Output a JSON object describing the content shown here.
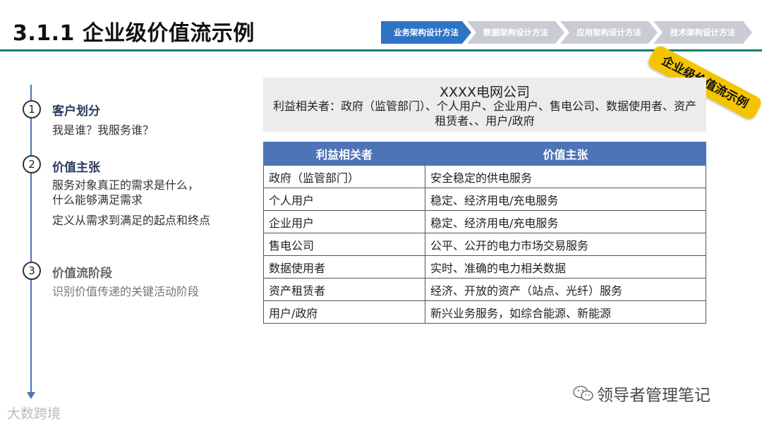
{
  "header": {
    "title": "3.1.1 企业级价值流示例",
    "breadcrumbs": [
      {
        "label": "业务架构设计方法",
        "active": true
      },
      {
        "label": "数据架构设计方法",
        "active": false
      },
      {
        "label": "应用架构设计方法",
        "active": false
      },
      {
        "label": "技术架构设计方法",
        "active": false
      }
    ],
    "badge": "企业级价值流示例"
  },
  "steps": [
    {
      "num": "1",
      "title": "客户划分",
      "desc": [
        "我是谁？我服务谁？"
      ]
    },
    {
      "num": "2",
      "title": "价值主张",
      "desc": [
        "服务对象真正的需求是什么，",
        "什么能够满足需求",
        "定义从需求到满足的起点和终点"
      ]
    },
    {
      "num": "3",
      "title": "价值流阶段",
      "desc": [
        "识别价值传递的关键活动阶段"
      ]
    }
  ],
  "company": {
    "name": "XXXX电网公司",
    "stakeholders": "利益相关者：政府（监管部门）、个人用户、企业用户、售电公司、数据使用者、资产租赁者、、用户/政府"
  },
  "table": {
    "headers": [
      "利益相关者",
      "价值主张"
    ],
    "rows": [
      [
        "政府（监管部门）",
        "安全稳定的供电服务"
      ],
      [
        "个人用户",
        "稳定、经济用电/充电服务"
      ],
      [
        "企业用户",
        "稳定、经济用电/充电服务"
      ],
      [
        "售电公司",
        "公平、公开的电力市场交易服务"
      ],
      [
        "数据使用者",
        "实时、准确的电力相关数据"
      ],
      [
        "资产租赁者",
        "经济、开放的资产（站点、光纤）服务"
      ],
      [
        "用户/政府",
        "新兴业务服务，如综合能源、新能源"
      ]
    ]
  },
  "footer": {
    "watermark": "领导者管理笔记",
    "corner_logo": "大数跨境"
  },
  "colors": {
    "accent": "#2f73c4",
    "table_header": "#4f73b7",
    "title_rule": "#1b7a6b",
    "badge": "#f5c400"
  }
}
